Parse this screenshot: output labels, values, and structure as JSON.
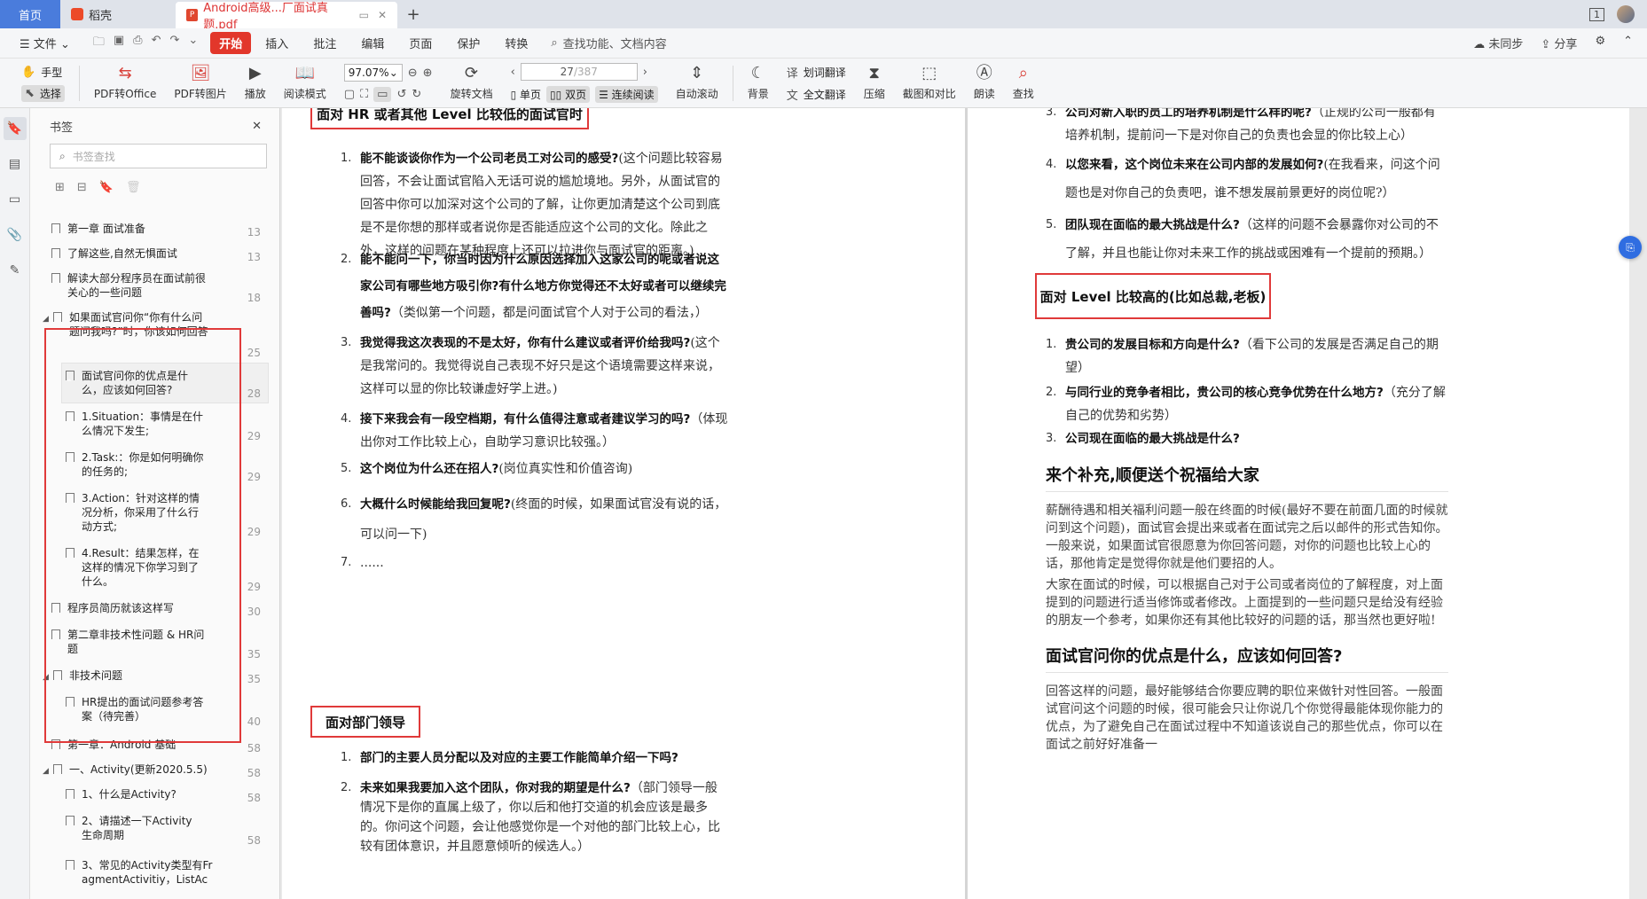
{
  "tabs": {
    "home": "首页",
    "wps": "稻壳",
    "doc": "Android高级...厂面试真题.pdf",
    "page_count_badge": "1"
  },
  "menu": {
    "file": "文件",
    "start": "开始",
    "insert": "插入",
    "annotate": "批注",
    "edit": "编辑",
    "page": "页面",
    "protect": "保护",
    "convert": "转换",
    "search": "查找功能、文档内容",
    "sync": "未同步",
    "share": "分享"
  },
  "toolbar": {
    "hand": "手型",
    "select": "选择",
    "pdf_to_office": "PDF转Office",
    "pdf_to_image": "PDF转图片",
    "play": "播放",
    "read_mode": "阅读模式",
    "zoom": "97.07%",
    "page_current": "27",
    "page_total": "/387",
    "rotate": "旋转文档",
    "single": "单页",
    "double": "双页",
    "continuous": "连续阅读",
    "auto_scroll": "自动滚动",
    "background": "背景",
    "word_translate": "划词翻译",
    "full_translate": "全文翻译",
    "compress": "压缩",
    "screenshot": "截图和对比",
    "read_aloud": "朗读",
    "find": "查找"
  },
  "bookmarks": {
    "title": "书签",
    "search_placeholder": "书签查找",
    "items": [
      {
        "text": "第一章 面试准备",
        "page": "13"
      },
      {
        "text": "了解这些,自然无惧面试",
        "page": "13"
      },
      {
        "text": "解读大部分程序员在面试前很关心的一些问题",
        "page": "18"
      },
      {
        "text": "如果面试官问你“你有什么问题问我吗?”时，你该如何回答",
        "page": "25"
      },
      {
        "text": "面试官问你的优点是什么，应该如何回答?",
        "page": "28"
      },
      {
        "text": "1.Situation：事情是在什么情况下发生;",
        "page": "29"
      },
      {
        "text": "2.Task:：你是如何明确你的任务的;",
        "page": "29"
      },
      {
        "text": "3.Action：针对这样的情况分析，你采用了什么行动方式;",
        "page": "29"
      },
      {
        "text": "4.Result：结果怎样，在这样的情况下你学习到了什么。",
        "page": "29"
      },
      {
        "text": "程序员简历就该这样写",
        "page": "30"
      },
      {
        "text": "第二章非技术性问题 & HR问题",
        "page": "35"
      },
      {
        "text": "非技术问题",
        "page": "35"
      },
      {
        "text": "HR提出的面试问题参考答案（待完善）",
        "page": "40"
      },
      {
        "text": "第一章：Android 基础",
        "page": "58"
      },
      {
        "text": "一、Activity(更新2020.5.5)",
        "page": "58"
      },
      {
        "text": "1、什么是Activity?",
        "page": "58"
      },
      {
        "text": "2、请描述一下Activity 生命周期",
        "page": "58"
      },
      {
        "text": "3、常见的Activity类型有FragmentActivitiy，ListAc",
        "page": ""
      }
    ]
  },
  "page1": {
    "section1_title": "面对 HR 或者其他 Level 比较低的面试官时",
    "q1_bold": "能不能谈谈你作为一个公司老员工对公司的感受?",
    "q1_rest": "(这个问题比较容易回答，不会让面试官陷入无话可说的尴尬境地。另外，从面试官的回答中你可以加深对这个公司的了解，让你更加清楚这个公司到底是不是你想的那样或者说你是否能适应这个公司的文化。除此之外，这样的问题在某种程度上还可以拉进你与面试官的距离。)",
    "q2_bold": "能不能问一下，你当时因为什么原因选择加入这家公司的呢或者说这家公司有哪些地方吸引你?有什么地方你觉得还不太好或者可以继续完善吗?",
    "q2_rest": "（类似第一个问题，都是问面试官个人对于公司的看法，）",
    "q3_bold": "我觉得我这次表现的不是太好，你有什么建议或者评价给我吗?",
    "q3_rest": "(这个是我常问的。我觉得说自己表现不好只是这个语境需要这样来说，这样可以显的你比较谦虚好学上进。)",
    "q4_bold": "接下来我会有一段空档期，有什么值得注意或者建议学习的吗?",
    "q4_rest": "（体现出你对工作比较上心，自助学习意识比较强。）",
    "q5_bold": "这个岗位为什么还在招人?",
    "q5_rest": "(岗位真实性和价值咨询)",
    "q6_bold": "大概什么时候能给我回复呢?",
    "q6_rest": "(终面的时候，如果面试官没有说的话，可以问一下)",
    "q7": "......",
    "section2_title": "面对部门领导",
    "d1_bold": "部门的主要人员分配以及对应的主要工作能简单介绍一下吗?",
    "d2_bold": "未来如果我要加入这个团队，你对我的期望是什么?",
    "d2_rest": "（部门领导一般情况下是你的直属上级了，你以后和他打交道的机会应该是最多的。你问这个问题，会让他感觉你是一个对他的部门比较上心，比较有团体意识，并且愿意倾听的候选人。）"
  },
  "page2": {
    "r3_bold": "公司对新入职的员工的培养机制是什么样的呢?",
    "r3_rest": "（正规的公司一般都有培养机制，提前问一下是对你自己的负责也会显的你比较上心）",
    "r4_bold": "以您来看，这个岗位未来在公司内部的发展如何?",
    "r4_rest": "(在我看来，问这个问题也是对你自己的负责吧，谁不想发展前景更好的岗位呢?）",
    "r5_bold": "团队现在面临的最大挑战是什么?",
    "r5_rest": "（这样的问题不会暴露你对公司的不了解，并且也能让你对未来工作的挑战或困难有一个提前的预期。）",
    "section3_title": "面对 Level 比较高的(比如总裁,老板)",
    "b1_bold": "贵公司的发展目标和方向是什么?",
    "b1_rest": "（看下公司的发展是否满足自己的期望）",
    "b2_bold": "与同行业的竞争者相比，贵公司的核心竞争优势在什么地方?",
    "b2_rest": "（充分了解自己的优势和劣势）",
    "b3_bold": "公司现在面临的最大挑战是什么?",
    "h_supp": "来个补充,顺便送个祝福给大家",
    "supp_p1": "薪酬待遇和相关福利问题一般在终面的时候(最好不要在前面几面的时候就问到这个问题)，面试官会提出来或者在面试完之后以邮件的形式告知你。一般来说，如果面试官很愿意为你回答问题，对你的问题也比较上心的话，那他肯定是觉得你就是他们要招的人。",
    "supp_p2": "大家在面试的时候，可以根据自己对于公司或者岗位的了解程度，对上面提到的问题进行适当修饰或者修改。上面提到的一些问题只是给没有经验的朋友一个参考，如果你还有其他比较好的问题的话，那当然也更好啦!",
    "h_strength": "面试官问你的优点是什么，应该如何回答?",
    "strength_p": "回答这样的问题，最好能够结合你要应聘的职位来做针对性回答。一般面试官问这个问题的时候，很可能会只让你说几个你觉得最能体现你能力的优点，为了避免自己在面试过程中不知道该说自己的那些优点，你可以在面试之前好好准备一"
  }
}
